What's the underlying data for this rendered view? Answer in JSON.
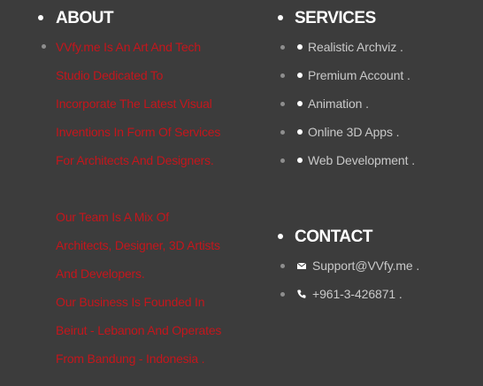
{
  "about": {
    "heading": "ABOUT",
    "lines": [
      "VVfy.me Is An Art And Tech",
      "Studio Dedicated To",
      "Incorporate The Latest Visual",
      "Inventions In Form Of Services",
      "For Architects And Designers.",
      "",
      "Our Team Is A Mix Of",
      "Architects, Designer, 3D Artists",
      "And Developers.",
      "Our Business Is Founded In",
      "Beirut - Lebanon And Operates",
      "From Bandung - Indonesia ."
    ]
  },
  "services": {
    "heading": "SERVICES",
    "items": [
      "Realistic Archviz .",
      "Premium Account .",
      "Animation .",
      "Online 3D Apps .",
      "Web Development ."
    ]
  },
  "contact": {
    "heading": "CONTACT",
    "email": "Support@VVfy.me .",
    "phone": "+961-3-426871 ."
  },
  "colors": {
    "background": "#3c3c3c",
    "about_text": "#c4161c",
    "heading": "#ffffff",
    "body_text": "#c9c9c9"
  }
}
